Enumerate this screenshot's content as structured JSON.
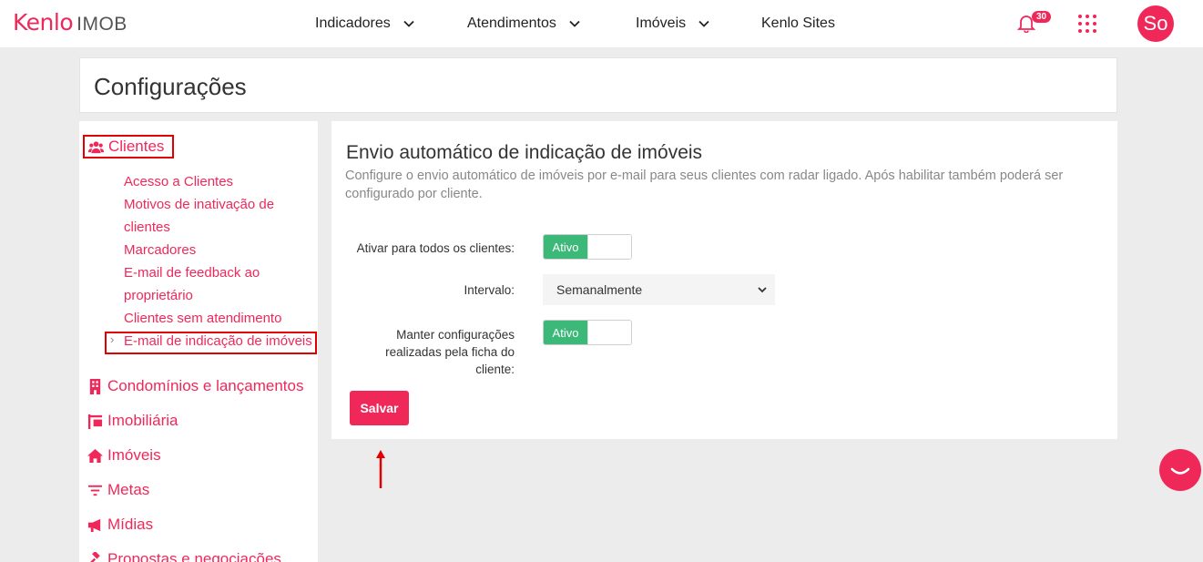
{
  "header": {
    "brand": "Kenlo",
    "product": "IMOB",
    "nav": [
      {
        "label": "Indicadores"
      },
      {
        "label": "Atendimentos"
      },
      {
        "label": "Imóveis"
      },
      {
        "label": "Kenlo Sites"
      }
    ],
    "notification_count": "30",
    "avatar_initials": "So"
  },
  "page": {
    "title": "Configurações"
  },
  "sidebar": {
    "clientes_label": "Clientes",
    "clientes_items": [
      "Acesso a Clientes",
      "Motivos de inativação de clientes",
      "Marcadores",
      "E-mail de feedback ao proprietário",
      "Clientes sem atendimento",
      "E-mail de indicação de imóveis"
    ],
    "sections": [
      {
        "label": "Condomínios e lançamentos",
        "icon": "building-icon"
      },
      {
        "label": "Imobiliária",
        "icon": "sign-icon"
      },
      {
        "label": "Imóveis",
        "icon": "home-icon"
      },
      {
        "label": "Metas",
        "icon": "filter-icon"
      },
      {
        "label": "Mídias",
        "icon": "megaphone-icon"
      },
      {
        "label": "Propostas e negociações",
        "icon": "gavel-icon"
      }
    ]
  },
  "main": {
    "title": "Envio automático de indicação de imóveis",
    "description": "Configure o envio automático de imóveis por e-mail para seus clientes com radar ligado. Após habilitar também poderá ser configurado por cliente.",
    "fields": {
      "activate_all_label": "Ativar para todos os clientes:",
      "activate_all_value": "Ativo",
      "interval_label": "Intervalo:",
      "interval_value": "Semanalmente",
      "keep_settings_label": "Manter configurações realizadas pela ficha do cliente:",
      "keep_settings_value": "Ativo"
    },
    "save_label": "Salvar"
  },
  "colors": {
    "brand": "#f0285a",
    "toggle_on": "#3cb878",
    "annotation": "#e00000"
  }
}
